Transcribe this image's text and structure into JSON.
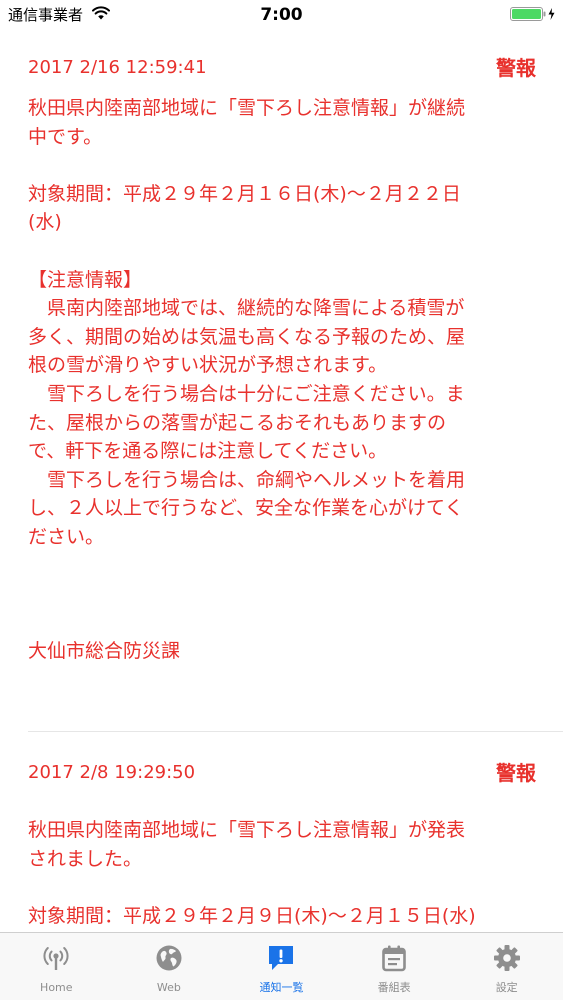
{
  "status_bar": {
    "carrier": "通信事業者",
    "time": "7:00"
  },
  "notices": [
    {
      "date": "2017 2/16 12:59:41",
      "level": "警報",
      "body": "秋田県内陸南部地域に「雪下ろし注意情報」が継続\n中です。\n\n対象期間：平成２９年２月１６日(木)～２月２２日\n(水)\n\n【注意情報】\n　県南内陸部地域では、継続的な降雪による積雪が\n多く、期間の始めは気温も高くなる予報のため、屋\n根の雪が滑りやすい状況が予想されます。\n　雪下ろしを行う場合は十分にご注意ください。ま\nた、屋根からの落雪が起こるおそれもありますの\nで、軒下を通る際には注意してください。\n　雪下ろしを行う場合は、命綱やヘルメットを着用\nし、２人以上で行うなど、安全な作業を心がけてく\nださい。\n\n\n\n大仙市総合防災課"
    },
    {
      "date": "2017 2/8 19:29:50",
      "level": "警報",
      "body": "秋田県内陸南部地域に「雪下ろし注意情報」が発表\nされました。\n\n対象期間：平成２９年２月９日(木)～２月１５日(水)"
    }
  ],
  "tabs": [
    {
      "label": "Home",
      "icon": "broadcast-icon",
      "active": false
    },
    {
      "label": "Web",
      "icon": "globe-icon",
      "active": false
    },
    {
      "label": "通知一覧",
      "icon": "notification-icon",
      "active": true
    },
    {
      "label": "番組表",
      "icon": "calendar-icon",
      "active": false
    },
    {
      "label": "設定",
      "icon": "gear-icon",
      "active": false
    }
  ],
  "colors": {
    "text_alert": "#e8312d",
    "tab_active": "#1a73e8",
    "tab_inactive": "#8e8e8e",
    "battery": "#4cd964"
  }
}
